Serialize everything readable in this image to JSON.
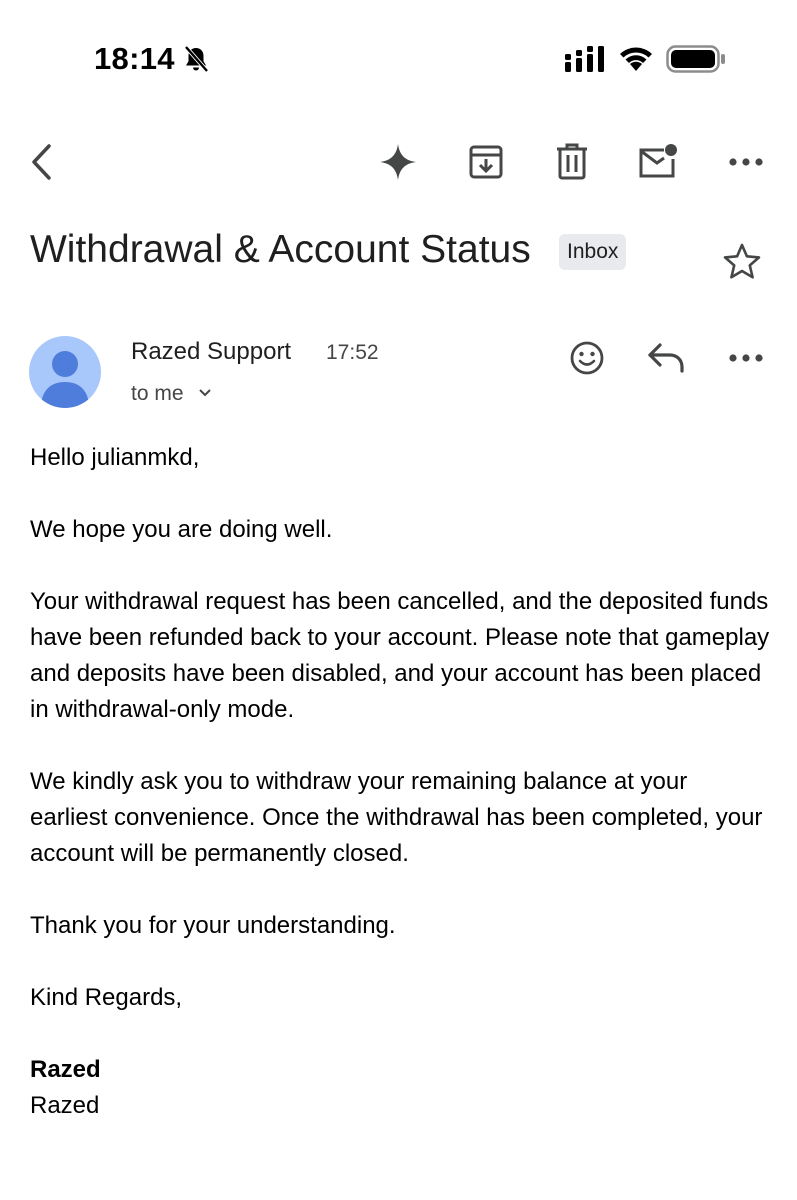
{
  "status_bar": {
    "time": "18:14"
  },
  "toolbar": {
    "back_icon": "chevron-left-icon",
    "ai_icon": "sparkle-icon",
    "archive_icon": "archive-icon",
    "delete_icon": "trash-icon",
    "unread_icon": "mark-unread-icon",
    "more_icon": "more-horizontal-icon"
  },
  "email": {
    "subject": "Withdrawal & Account Status",
    "label": "Inbox",
    "sender": "Razed Support",
    "time": "17:52",
    "recipient": "to me",
    "body": {
      "greeting": "Hello julianmkd,",
      "p1": "We hope you are doing well.",
      "p2": "Your withdrawal request has been cancelled, and the deposited funds have been refunded back to your account. Please note that gameplay and deposits have been disabled, and your account has been placed in withdrawal-only mode.",
      "p3": "We kindly ask you to withdraw your remaining balance at your earliest convenience. Once the withdrawal has been completed, your account will be permanently closed.",
      "p4": "Thank you for your understanding.",
      "closing": "Kind Regards,",
      "signature_bold": "Razed",
      "signature": "Razed"
    }
  },
  "colors": {
    "avatar_bg": "#a8c7fa",
    "avatar_fg": "#4f7ddb",
    "badge_bg": "#e8eaed",
    "icon": "#444746"
  }
}
